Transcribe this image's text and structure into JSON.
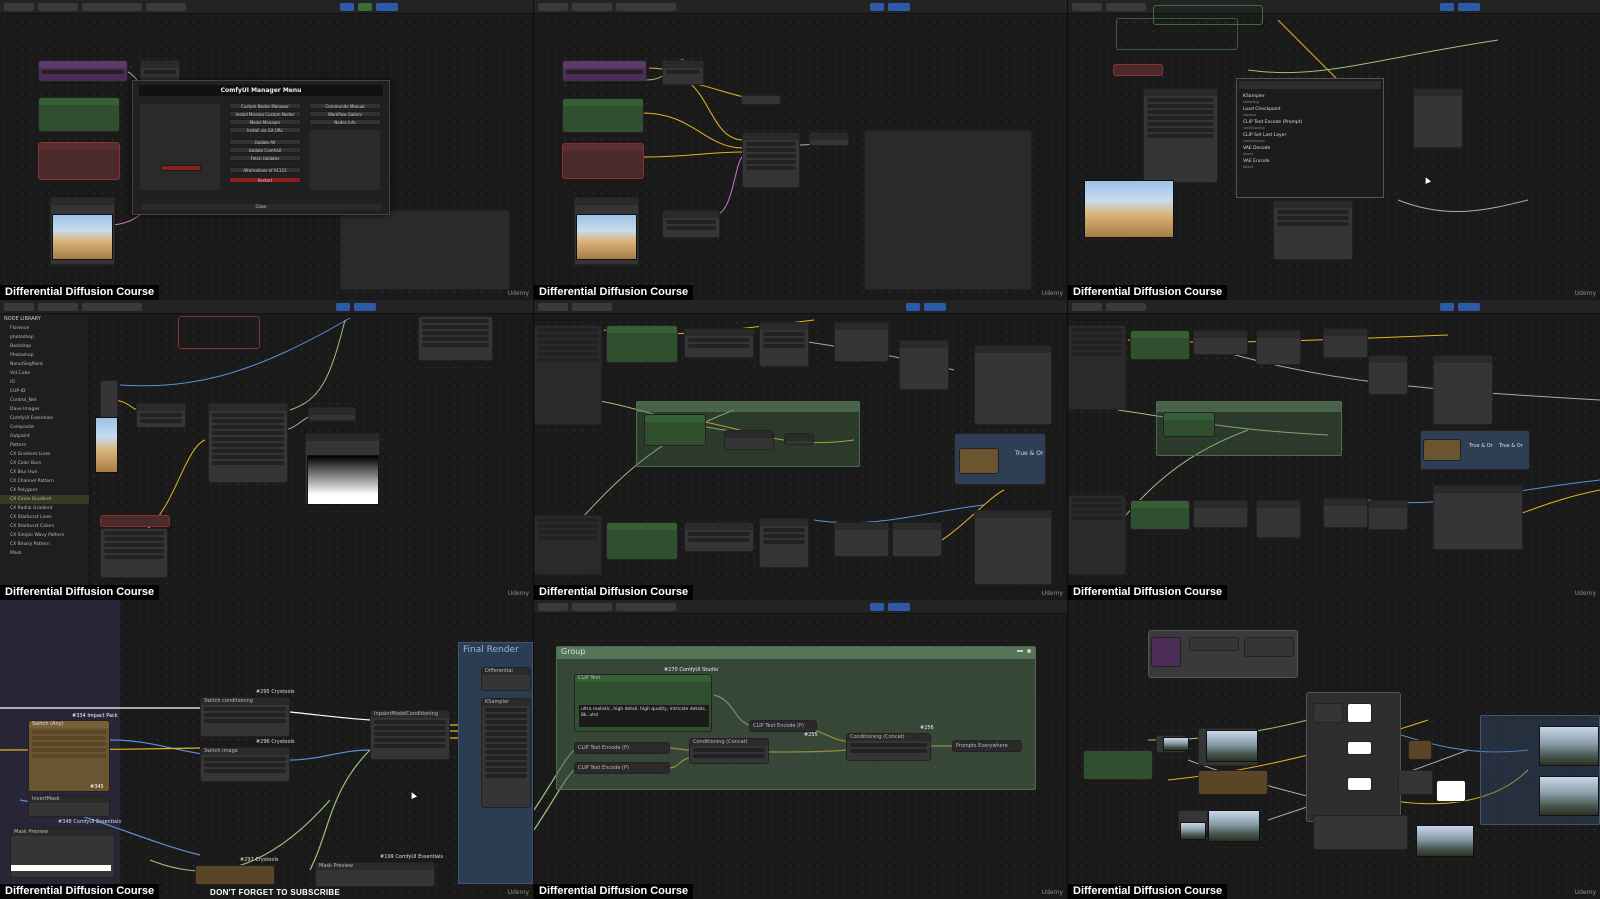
{
  "caption": "Differential Diffusion Course",
  "watermark": "Udemy",
  "subscribe": "DON'T FORGET TO SUBSCRIBE",
  "manager_menu": {
    "title": "ComfyUI Manager Menu",
    "left_buttons": [
      "Custom Nodes Manager",
      "Install Missing Custom Nodes",
      "Model Manager",
      "Install via Git URL",
      "Update All",
      "Update ComfyUI",
      "Fetch Updates",
      "Alternatives of A1111"
    ],
    "right_buttons": [
      "Community Manual",
      "Workflow Gallery",
      "Nodes Info"
    ],
    "restart": "Restart",
    "close": "Close"
  },
  "search_popup": {
    "items": [
      {
        "title": "KSampler",
        "sub": "sampling"
      },
      {
        "title": "Load Checkpoint",
        "sub": "loaders"
      },
      {
        "title": "CLIP Text Encode (Prompt)",
        "sub": "conditioning"
      },
      {
        "title": "CLIP Set Last Layer",
        "sub": "conditioning"
      },
      {
        "title": "VAE Decode",
        "sub": "latent"
      },
      {
        "title": "VAE Encode",
        "sub": "latent"
      }
    ]
  },
  "library": {
    "title": "NODE LIBRARY",
    "items": [
      "Florence",
      "photoshop",
      "Backdrop",
      "Photoshop",
      "Nano/SegPaint",
      "Vid.Cube",
      "IO",
      "CUP-ID",
      "Control_Net",
      "Dave Images",
      "ComfyUI Essentials",
      "Composite",
      "Outpaint",
      "Pattern",
      "CX Gradient Lines",
      "CX Color Burn",
      "CX Blur Hue",
      "CX Channel Pattern",
      "CX Polygons",
      "CX Circle Gradient",
      "CX Radial Gradient",
      "CX Starburst Lines",
      "CX Starburst Colors",
      "CX Simple Wavy Pattern",
      "CX Binary Pattern",
      "Mask"
    ]
  },
  "t7_labels": {
    "final_render": "Final Render",
    "switch_any": "Switch (Any)",
    "switch_cond": "Switch conditioning",
    "switch_image": "Switch image",
    "invert_mask": "InvertMask",
    "mask_preview": "Mask Preview",
    "inpaint_cond": "InpaintModelConditioning",
    "differential": "Differential",
    "ksampler": "KSampler",
    "badge1": "#295 Crystools",
    "badge2": "#334 Impact Pack",
    "badge3": "#296 Crystools",
    "badge4": "#345",
    "badge5": "#348 ComfyUI Essentials",
    "badge6": "#297 Crystools",
    "badge7": "#199 ComfyUI Essentials"
  },
  "t8_labels": {
    "group": "Group",
    "clip_text": "CLIP Text",
    "prompt_text": "ultra realistic, high detail, high quality, intricate details, 8k, uhd",
    "clip_encode_1": "CLIP Text Encode (P)",
    "clip_encode_2": "CLIP Text Encode (P)",
    "clip_encode_3": "CLIP Text Encode (P)",
    "cond_concat_1": "Conditioning (Concat)",
    "cond_concat_2": "Conditioning (Concat)",
    "prompts_everywhere": "Prompts Everywhere",
    "badge": "#270 ComfyUI Studio",
    "badge2": "#255",
    "badge3": "#256"
  },
  "t5_labels": {
    "true_or": "True & Or"
  },
  "t6_labels": {
    "true_or_1": "True & Or",
    "true_or_2": "True & Or"
  },
  "colors": {
    "caption_bg": "#000000",
    "node_green": "#2f4f2f",
    "node_purple": "#4b2d55",
    "group_green": "#507850",
    "wire_yellow": "#e6b422",
    "wire_green": "#9bc27b",
    "wire_blue": "#5b8fd9",
    "wire_pink": "#d070c8"
  }
}
